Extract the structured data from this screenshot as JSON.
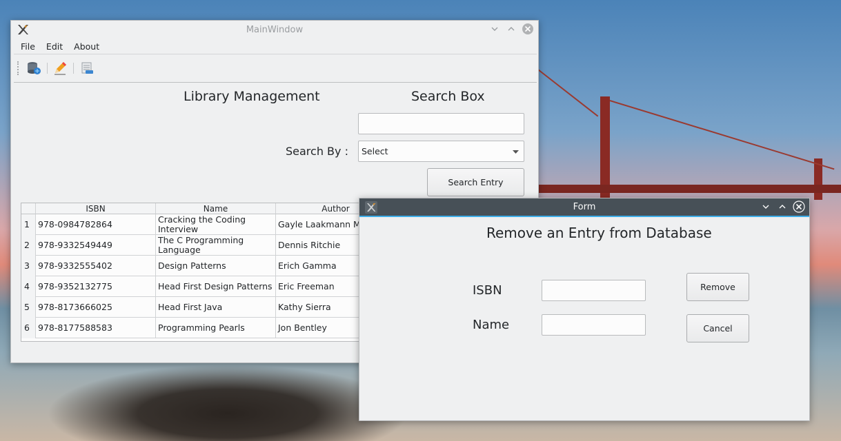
{
  "main_window": {
    "title": "MainWindow",
    "menu": [
      "File",
      "Edit",
      "About"
    ],
    "heading": "Library Management",
    "search_heading": "Search Box",
    "search_input_value": "",
    "search_by_label": "Search By :",
    "search_by_value": "Select",
    "search_button": "Search Entry",
    "table": {
      "columns": [
        "ISBN",
        "Name",
        "Author"
      ],
      "rows": [
        {
          "num": "1",
          "isbn": "978-0984782864",
          "name": "Cracking the Coding Interview",
          "author": "Gayle Laakmann Mc"
        },
        {
          "num": "2",
          "isbn": "978-9332549449",
          "name": "The C Programming Language",
          "author": "Dennis Ritchie"
        },
        {
          "num": "3",
          "isbn": "978-9332555402",
          "name": "Design Patterns",
          "author": "Erich Gamma"
        },
        {
          "num": "4",
          "isbn": "978-9352132775",
          "name": "Head First Design Patterns",
          "author": "Eric Freeman"
        },
        {
          "num": "5",
          "isbn": "978-8173666025",
          "name": "Head First Java",
          "author": "Kathy Sierra"
        },
        {
          "num": "6",
          "isbn": "978-8177588583",
          "name": "Programming Pearls",
          "author": "Jon Bentley"
        }
      ]
    },
    "toolbar_icons": [
      "database-icon",
      "pencil-icon",
      "document-remove-icon"
    ]
  },
  "form_window": {
    "title": "Form",
    "heading": "Remove an Entry from Database",
    "isbn_label": "ISBN",
    "name_label": "Name",
    "isbn_value": "",
    "name_value": "",
    "remove_button": "Remove",
    "cancel_button": "Cancel"
  },
  "colors": {
    "window_bg": "#eff0f1",
    "active_titlebar": "#475057",
    "accent": "#3daee9"
  }
}
